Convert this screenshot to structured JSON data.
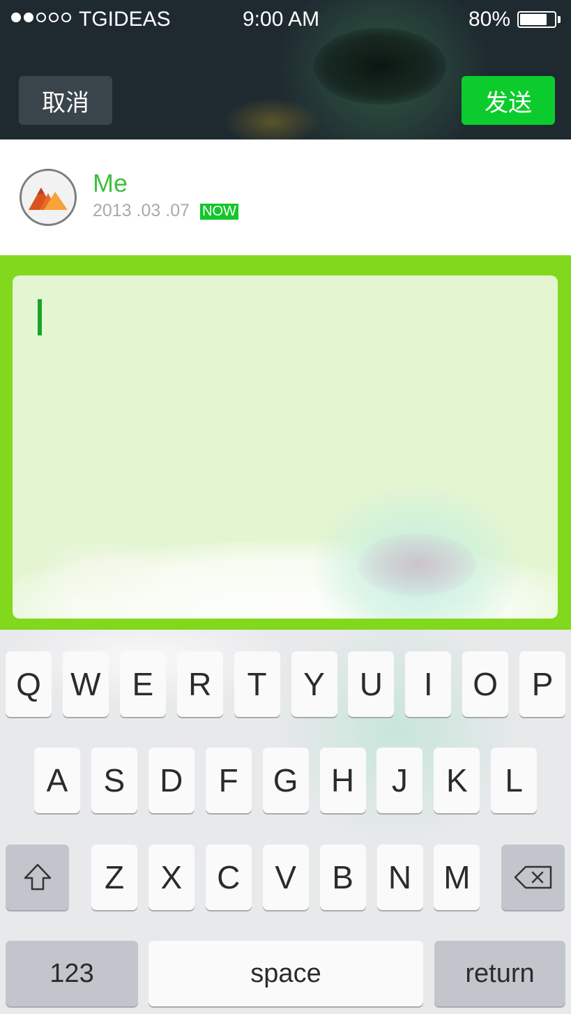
{
  "status_bar": {
    "carrier": "TGIDEAS",
    "time": "9:00 AM",
    "battery_percent": "80%",
    "battery_level": 0.8,
    "signal_bars": 2,
    "signal_total": 5
  },
  "header": {
    "cancel_label": "取消",
    "send_label": "发送"
  },
  "user": {
    "name": "Me",
    "date": "2013 .03 .07",
    "now_badge": "NOW"
  },
  "compose": {
    "text": ""
  },
  "keyboard": {
    "row1": [
      "Q",
      "W",
      "E",
      "R",
      "T",
      "Y",
      "U",
      "I",
      "O",
      "P"
    ],
    "row2": [
      "A",
      "S",
      "D",
      "F",
      "G",
      "H",
      "J",
      "K",
      "L"
    ],
    "row3": [
      "Z",
      "X",
      "C",
      "V",
      "B",
      "N",
      "M"
    ],
    "numbers_label": "123",
    "space_label": "space",
    "return_label": "return",
    "shift_icon": "shift-arrow-icon",
    "delete_icon": "backspace-icon"
  },
  "colors": {
    "header_bg": "#1f2a30",
    "send_green": "#0bcc2c",
    "name_green": "#3fbf3f",
    "compose_border_green": "#82d81c",
    "compose_fill": "#e4f5d2",
    "cursor_green": "#1aa52a"
  }
}
